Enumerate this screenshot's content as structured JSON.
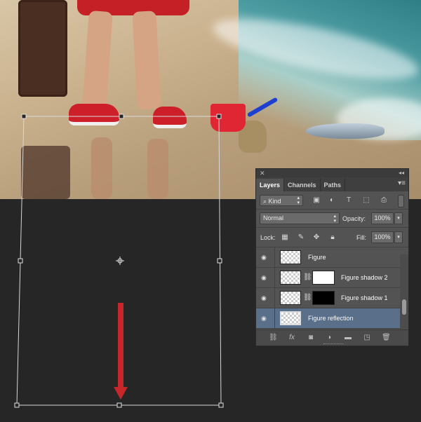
{
  "colors": {
    "canvas_background": "#262626",
    "transform_bounds": "#d8d8d8",
    "arrow": "#c5272a",
    "panel_bg": "#535353",
    "selected_layer": "#596f8a"
  },
  "panel": {
    "tabs": [
      {
        "label": "Layers",
        "active": true
      },
      {
        "label": "Channels",
        "active": false
      },
      {
        "label": "Paths",
        "active": false
      }
    ],
    "filter": {
      "kind_label": "Kind"
    },
    "blend_mode": "Normal",
    "opacity_label": "Opacity:",
    "opacity_value": "100%",
    "lock_label": "Lock:",
    "fill_label": "Fill:",
    "fill_value": "100%",
    "layers": [
      {
        "name": "Figure",
        "visible": true,
        "selected": false,
        "has_mask": false
      },
      {
        "name": "Figure shadow 2",
        "visible": true,
        "selected": false,
        "has_mask": true,
        "mask_color": "#ffffff"
      },
      {
        "name": "Figure shadow 1",
        "visible": true,
        "selected": false,
        "has_mask": true,
        "mask_color": "#000000"
      },
      {
        "name": "Figure reflection",
        "visible": true,
        "selected": true,
        "has_mask": false
      }
    ]
  },
  "icons": {
    "eye": "eye-icon",
    "link": "link-icon",
    "fx": "fx-icon",
    "mask": "add-mask-icon",
    "adjustment": "adjustment-layer-icon",
    "folder": "new-group-icon",
    "new_layer": "new-layer-icon",
    "trash": "trash-icon"
  }
}
